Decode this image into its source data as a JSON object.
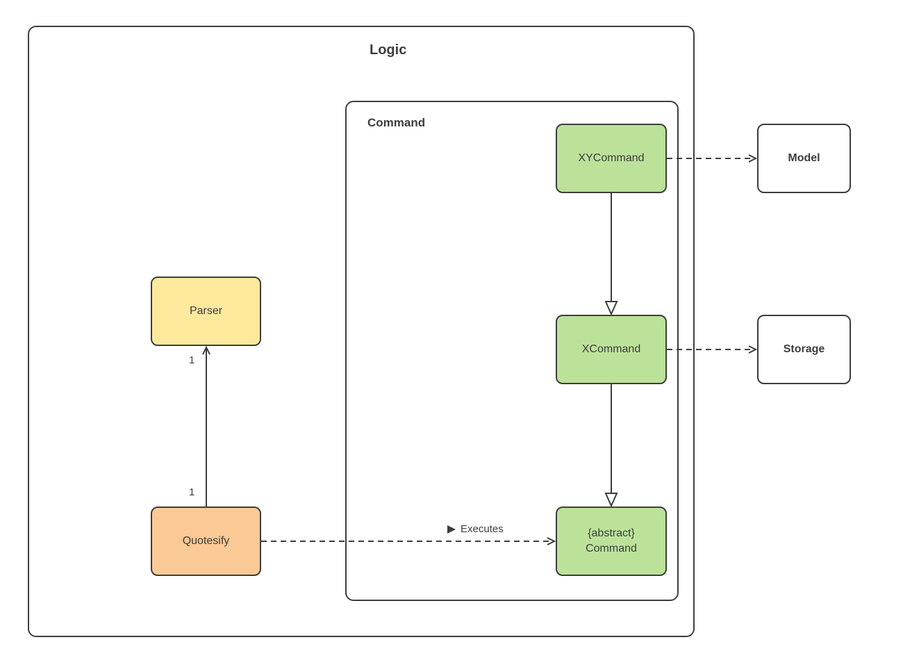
{
  "logic": {
    "title": "Logic"
  },
  "command_container": {
    "title": "Command"
  },
  "boxes": {
    "parser": "Parser",
    "quotesify": "Quotesify",
    "xycommand": "XYCommand",
    "xcommand": "XCommand",
    "abstract_line1": "{abstract}",
    "abstract_line2": "Command",
    "model": "Model",
    "storage": "Storage"
  },
  "labels": {
    "mult_top": "1",
    "mult_bottom": "1",
    "executes": "Executes"
  }
}
